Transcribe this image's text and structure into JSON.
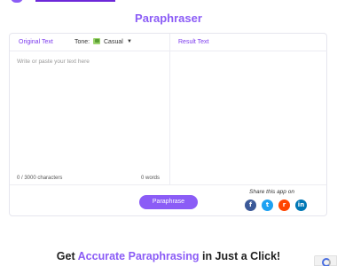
{
  "page": {
    "title": "Paraphraser"
  },
  "left_panel": {
    "tab_label": "Original Text",
    "tone_label": "Tone:",
    "tone_value": "Casual",
    "tone_icon": "casual-tone-icon",
    "input_placeholder": "Write or paste your text here",
    "input_value": "",
    "char_count": "0 / 3000 characters",
    "word_count": "0 words"
  },
  "right_panel": {
    "tab_label": "Result Text"
  },
  "actions": {
    "paraphrase_label": "Paraphrase"
  },
  "share": {
    "label": "Share this app on",
    "icons": [
      "facebook-icon",
      "twitter-icon",
      "reddit-icon",
      "linkedin-icon"
    ],
    "glyphs": {
      "facebook": "f",
      "twitter": "t",
      "reddit": "r",
      "linkedin": "in"
    }
  },
  "headline": {
    "prefix": "Get ",
    "accent": "Accurate Paraphrasing",
    "suffix": " in Just a Click!"
  },
  "colors": {
    "accent": "#8b5cf6",
    "facebook": "#3b5998",
    "twitter": "#1da1f2",
    "reddit": "#ff4500",
    "linkedin": "#0077b5"
  }
}
